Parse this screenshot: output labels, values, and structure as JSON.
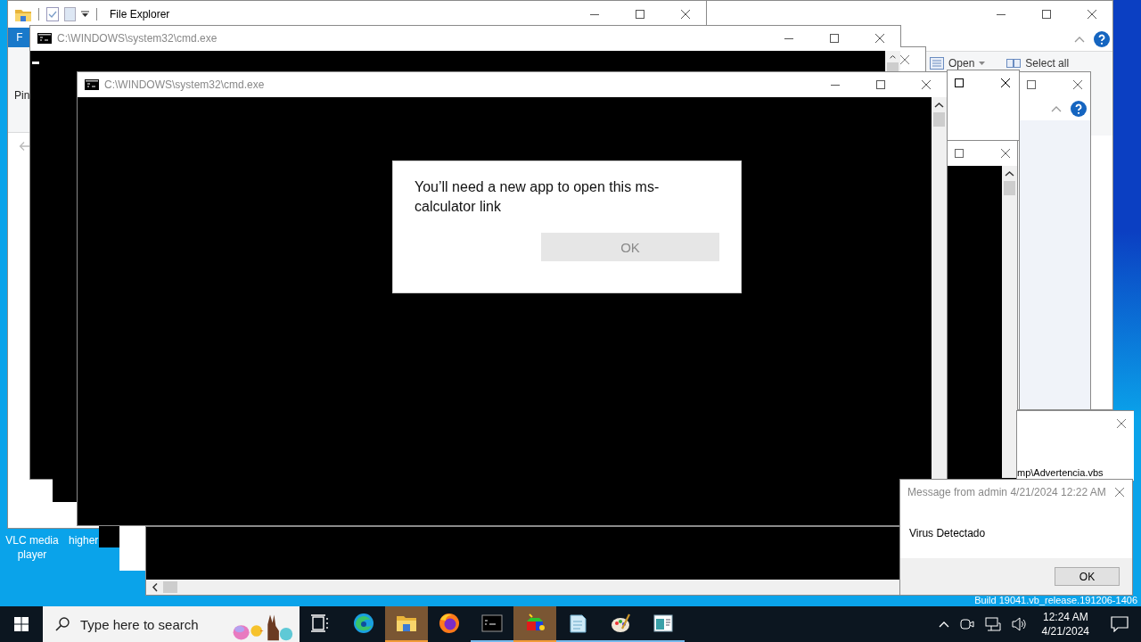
{
  "desktop": {
    "icons": [
      {
        "label": "VLC media player"
      },
      {
        "label": "higher"
      }
    ],
    "build": "Build 19041.vb_release.191206-1406"
  },
  "explorer": {
    "title": "File Explorer",
    "ribbon_tab": "F",
    "ribbon_label": "Pin"
  },
  "explorer_back": {
    "ribbon_items": [
      {
        "label": "Open",
        "kind": "dropdown"
      },
      {
        "label": "Select all",
        "kind": "button"
      }
    ]
  },
  "consoles": [
    {
      "title": "C:\\WINDOWS\\system32\\cmd.exe"
    },
    {
      "title": "C:\\WINDOWS\\system32\\cmd.exe"
    }
  ],
  "app_prompt": {
    "message": "You’ll need a new app to open this ms-calculator link",
    "button": "OK"
  },
  "script_window": {
    "path": "mp\\Advertencia.vbs"
  },
  "message_box": {
    "title": "Message from admin 4/21/2024 12:22 AM",
    "body": "Virus Detectado",
    "button": "OK"
  },
  "taskbar": {
    "search_placeholder": "Type here to search",
    "apps": [
      {
        "kind": "task-view",
        "open": false,
        "selected": false
      },
      {
        "kind": "edge",
        "open": false,
        "selected": false
      },
      {
        "kind": "explorer",
        "open": true,
        "selected": true
      },
      {
        "kind": "firefox",
        "open": false,
        "selected": false
      },
      {
        "kind": "terminal",
        "open": true,
        "selected": false
      },
      {
        "kind": "cube",
        "open": true,
        "selected": true
      },
      {
        "kind": "notepad",
        "open": true,
        "selected": false
      },
      {
        "kind": "paint",
        "open": true,
        "selected": false
      },
      {
        "kind": "window-app",
        "open": true,
        "selected": false
      }
    ],
    "time": "12:24 AM",
    "date": "4/21/2024"
  }
}
